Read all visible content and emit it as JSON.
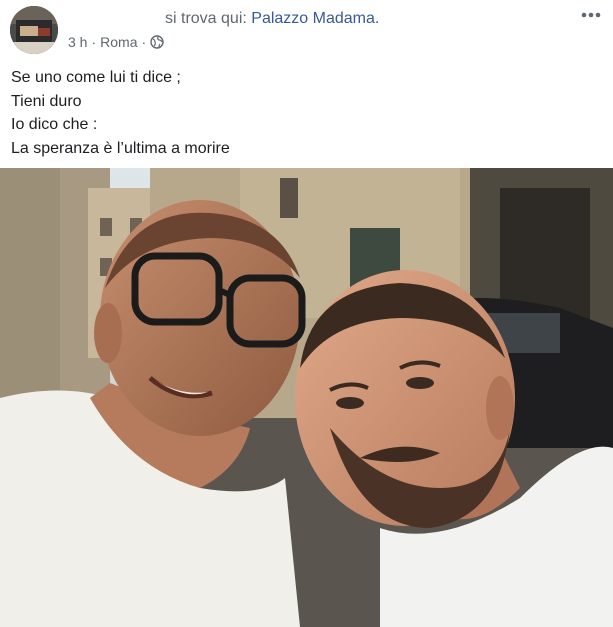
{
  "post": {
    "location_prefix": "si trova qui: ",
    "location_name": "Palazzo Madama",
    "location_suffix": ".",
    "time": "3 h",
    "separator1": "·",
    "place": "Roma",
    "separator2": "·",
    "privacy_icon": "globe-icon",
    "more_icon": "more-options-icon",
    "text_lines": [
      "Se uno come lui ti dice ;",
      "Tieni duro",
      "Io dico che :",
      "La speranza è l’ultima a morire"
    ],
    "photo": {
      "description_icon": "selfie-photo"
    }
  },
  "colors": {
    "link": "#385898",
    "meta": "#616770",
    "text": "#1c1e21"
  }
}
